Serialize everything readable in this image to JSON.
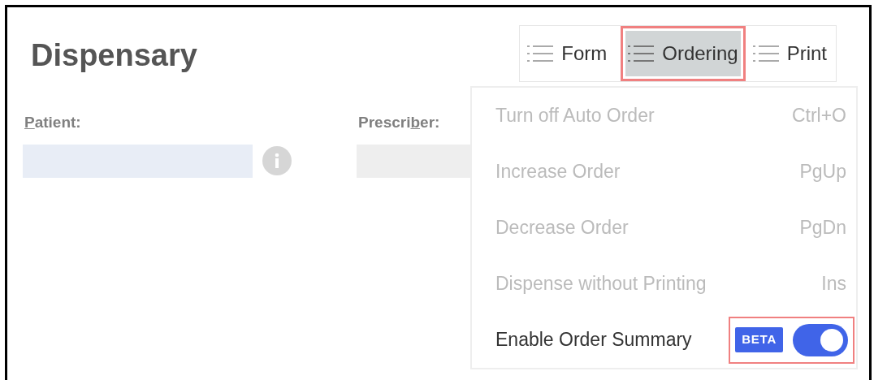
{
  "title": "Dispensary",
  "tabs": [
    {
      "label": "Form",
      "selected": false,
      "highlighted": false
    },
    {
      "label": "Ordering",
      "selected": true,
      "highlighted": true
    },
    {
      "label": "Print",
      "selected": false,
      "highlighted": false
    }
  ],
  "fields": [
    {
      "label_parts": [
        {
          "text": "P",
          "underlined": true
        },
        {
          "text": "atient:",
          "underlined": false
        }
      ],
      "info": true,
      "color": "#e8edf6"
    },
    {
      "label_parts": [
        {
          "text": "Prescri",
          "underlined": false
        },
        {
          "text": "b",
          "underlined": true
        },
        {
          "text": "er:",
          "underlined": false
        }
      ],
      "info": false,
      "color": "#eeeeee"
    }
  ],
  "menu": [
    {
      "kind": "command",
      "label": "Turn off Auto Order",
      "shortcut": "Ctrl+O",
      "disabled": true
    },
    {
      "kind": "command",
      "label": "Increase Order",
      "shortcut": "PgUp",
      "disabled": true
    },
    {
      "kind": "command",
      "label": "Decrease Order",
      "shortcut": "PgDn",
      "disabled": true
    },
    {
      "kind": "command",
      "label": "Dispense without Printing",
      "shortcut": "Ins",
      "disabled": true
    },
    {
      "kind": "toggle",
      "label": "Enable Order Summary",
      "badge": "BETA",
      "on": true,
      "disabled": false,
      "highlighted": true
    }
  ]
}
